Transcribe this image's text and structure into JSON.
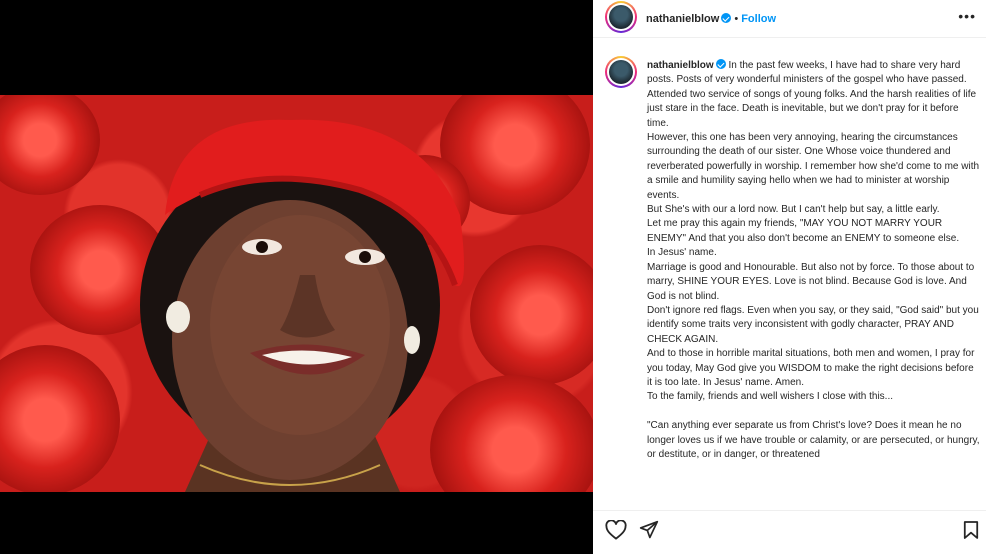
{
  "post": {
    "username": "nathanielblow",
    "follow_label": "Follow",
    "dot": "•",
    "more_label": "•••"
  },
  "caption": {
    "username": "nathanielblow",
    "text": "In the past few weeks, I have had to share very hard posts. Posts of very wonderful ministers of the gospel who have passed. Attended two service of songs of young folks. And the harsh realities of life just stare in the face. Death is inevitable, but we don't pray for it before time.\nHowever, this one has been very annoying, hearing the circumstances surrounding the death of our sister. One Whose voice thundered and reverberated powerfully in worship. I remember how she'd come to me with a smile and humility saying hello when we had to minister at worship events.\nBut She's with our a lord now. But I can't help but say, a little early.\nLet me pray this again my friends, \"MAY YOU NOT MARRY YOUR ENEMY\" And that you also don't become an ENEMY to someone else.\nIn Jesus' name.\nMarriage is good and Honourable. But also not by force. To those about to marry, SHINE YOUR EYES. Love is not blind. Because God is love. And God is not blind.\nDon't ignore red flags. Even when you say, or they said, \"God said\" but you identify some traits very inconsistent with godly character, PRAY AND CHECK AGAIN.\nAnd to those in horrible marital situations, both men and women, I pray for you today, May God give you WISDOM to make the right decisions before it is too late. In Jesus' name. Amen.\nTo the family, friends and well wishers I close with this...\n\n\"Can anything ever separate us from Christ's love? Does it mean he no longer loves us if we have trouble or calamity, or are persecuted, or hungry, or destitute, or in danger, or threatened"
  },
  "colors": {
    "accent": "#0095f6",
    "text": "#262626",
    "beret": "#e11d1d"
  },
  "icons": {
    "like": "heart-icon",
    "share": "send-icon",
    "save": "bookmark-icon",
    "more": "more-horizontal-icon",
    "verified": "verified-badge-icon"
  }
}
